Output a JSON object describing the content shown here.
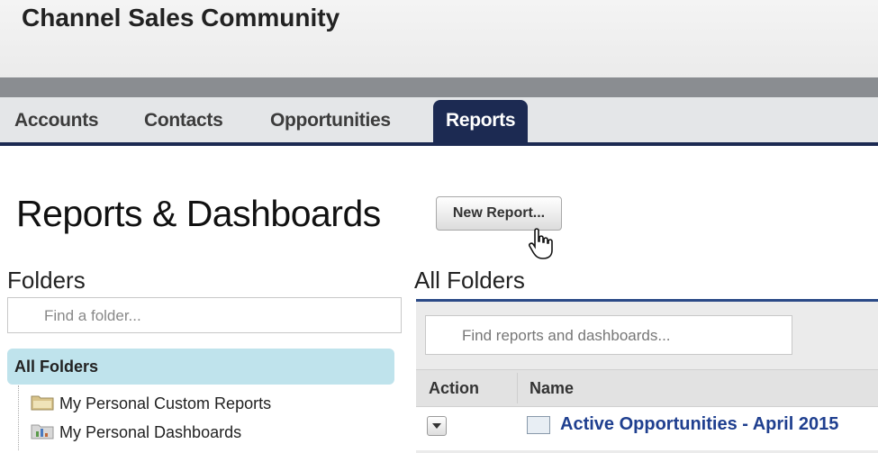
{
  "site": {
    "title": "Channel Sales Community"
  },
  "nav": {
    "tabs": [
      {
        "label": "Accounts"
      },
      {
        "label": "Contacts"
      },
      {
        "label": "Opportunities"
      },
      {
        "label": "Reports",
        "active": true
      }
    ]
  },
  "page": {
    "title": "Reports & Dashboards",
    "new_report_label": "New Report..."
  },
  "folders": {
    "heading": "Folders",
    "search_placeholder": "Find a folder...",
    "all_folders_label": "All Folders",
    "items": [
      {
        "label": "My Personal Custom Reports",
        "icon": "folder-icon"
      },
      {
        "label": "My Personal Dashboards",
        "icon": "dashboard-folder-icon"
      }
    ]
  },
  "main": {
    "heading": "All Folders",
    "search_placeholder": "Find reports and dashboards...",
    "columns": {
      "action": "Action",
      "name": "Name"
    },
    "rows": [
      {
        "name": "Active Opportunities - April 2015",
        "icon": "report-icon"
      }
    ]
  },
  "colors": {
    "active_tab": "#1c2a52",
    "selected_folder": "#bfe3ec",
    "link": "#1f3f8f"
  }
}
